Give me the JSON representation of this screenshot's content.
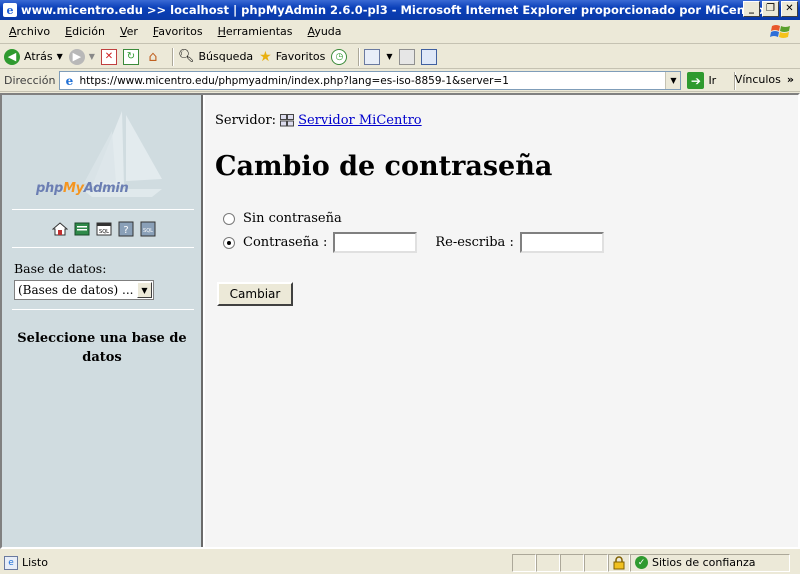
{
  "window": {
    "title": "www.micentro.edu >> localhost | phpMyAdmin 2.6.0-pl3 - Microsoft Internet Explorer proporcionado por MiCentro",
    "controls": [
      "_",
      "❐",
      "✕"
    ]
  },
  "menubar": {
    "items": [
      "Archivo",
      "Edición",
      "Ver",
      "Favoritos",
      "Herramientas",
      "Ayuda"
    ]
  },
  "toolbar": {
    "back_label": "Atrás",
    "search_label": "Búsqueda",
    "favorites_label": "Favoritos"
  },
  "addressbar": {
    "label": "Dirección",
    "url": "https://www.micentro.edu/phpmyadmin/index.php?lang=es-iso-8859-1&server=1",
    "go_label": "Ir",
    "links_label": "Vínculos"
  },
  "left": {
    "logo_php": "php",
    "logo_my": "My",
    "logo_admin": "Admin",
    "db_label": "Base de datos:",
    "db_select_value": "(Bases de datos) ...",
    "select_db_message": "Seleccione una base de datos"
  },
  "main": {
    "server_label": "Servidor:",
    "server_link": "Servidor MiCentro",
    "title": "Cambio de contraseña",
    "option_no_password": "Sin contraseña",
    "option_password": "Contraseña :",
    "retype_label": "Re-escriba :",
    "submit_label": "Cambiar"
  },
  "statusbar": {
    "status": "Listo",
    "zone": "Sitios de confianza"
  },
  "colors": {
    "titlebar": "#0a3fb8",
    "left_frame_bg": "#d0dce0",
    "link": "#0000cc"
  }
}
